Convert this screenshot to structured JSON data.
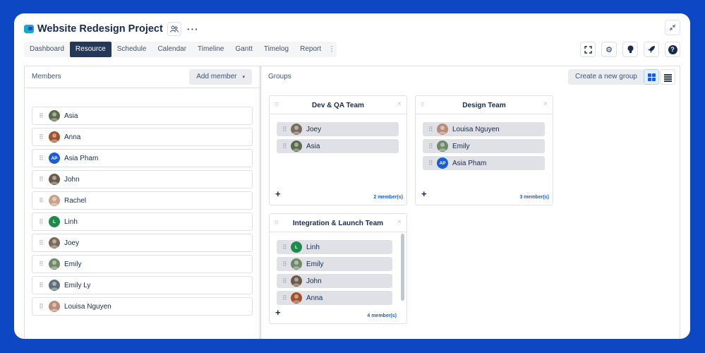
{
  "header": {
    "title": "Website Redesign Project",
    "members_icon": "people-icon",
    "more_glyph": "···",
    "collapse_glyph": "↙↗"
  },
  "tabs": [
    {
      "label": "Dashboard",
      "active": false
    },
    {
      "label": "Resource",
      "active": true
    },
    {
      "label": "Schedule",
      "active": false
    },
    {
      "label": "Calendar",
      "active": false
    },
    {
      "label": "Timeline",
      "active": false
    },
    {
      "label": "Gantt",
      "active": false
    },
    {
      "label": "Timelog",
      "active": false
    },
    {
      "label": "Report",
      "active": false
    }
  ],
  "tab_more_glyph": "⋮",
  "toolbar": {
    "icons": [
      "fullscreen-icon",
      "gear-icon",
      "lightbulb-icon",
      "rocket-icon",
      "help-icon"
    ],
    "fullscreen_glyph": "⛶",
    "gear_glyph": "⚙",
    "bulb_glyph": "●",
    "rocket_glyph": "➶",
    "help_glyph": "?"
  },
  "members_panel": {
    "title": "Members",
    "add_button": "Add member",
    "add_caret": "▾",
    "members": [
      {
        "name": "Asia",
        "initials": "",
        "color": "#5b6b4e"
      },
      {
        "name": "Anna",
        "initials": "",
        "color": "#a0522d"
      },
      {
        "name": "Asia Pham",
        "initials": "AP",
        "color": "#1a5fd0"
      },
      {
        "name": "John",
        "initials": "",
        "color": "#6b5a4b"
      },
      {
        "name": "Rachel",
        "initials": "",
        "color": "#c9a08a"
      },
      {
        "name": "Linh",
        "initials": "L",
        "color": "#1f8a4c"
      },
      {
        "name": "Joey",
        "initials": "",
        "color": "#7a6a5c"
      },
      {
        "name": "Emily",
        "initials": "",
        "color": "#6f8a6a"
      },
      {
        "name": "Emily Ly",
        "initials": "",
        "color": "#5f6f7a"
      },
      {
        "name": "Louisa Nguyen",
        "initials": "",
        "color": "#b98a78"
      }
    ]
  },
  "groups_panel": {
    "title": "Groups",
    "create_button": "Create a new group",
    "add_glyph": "+",
    "close_glyph": "×",
    "groups": [
      {
        "name": "Dev & QA Team",
        "count_label": "2 member(s)",
        "members": [
          {
            "name": "Joey",
            "initials": "",
            "color": "#7a6a5c"
          },
          {
            "name": "Asia",
            "initials": "",
            "color": "#5b6b4e"
          }
        ]
      },
      {
        "name": "Design Team",
        "count_label": "3 member(s)",
        "members": [
          {
            "name": "Louisa Nguyen",
            "initials": "",
            "color": "#b98a78"
          },
          {
            "name": "Emily",
            "initials": "",
            "color": "#6f8a6a"
          },
          {
            "name": "Asia Pham",
            "initials": "AP",
            "color": "#1a5fd0"
          }
        ]
      },
      {
        "name": "Integration & Launch Team",
        "count_label": "4 member(s)",
        "members": [
          {
            "name": "Linh",
            "initials": "L",
            "color": "#1f8a4c"
          },
          {
            "name": "Emily",
            "initials": "",
            "color": "#6f8a6a"
          },
          {
            "name": "John",
            "initials": "",
            "color": "#6b5a4b"
          },
          {
            "name": "Anna",
            "initials": "",
            "color": "#a0522d"
          }
        ]
      }
    ]
  },
  "grip_glyph": "⠿"
}
